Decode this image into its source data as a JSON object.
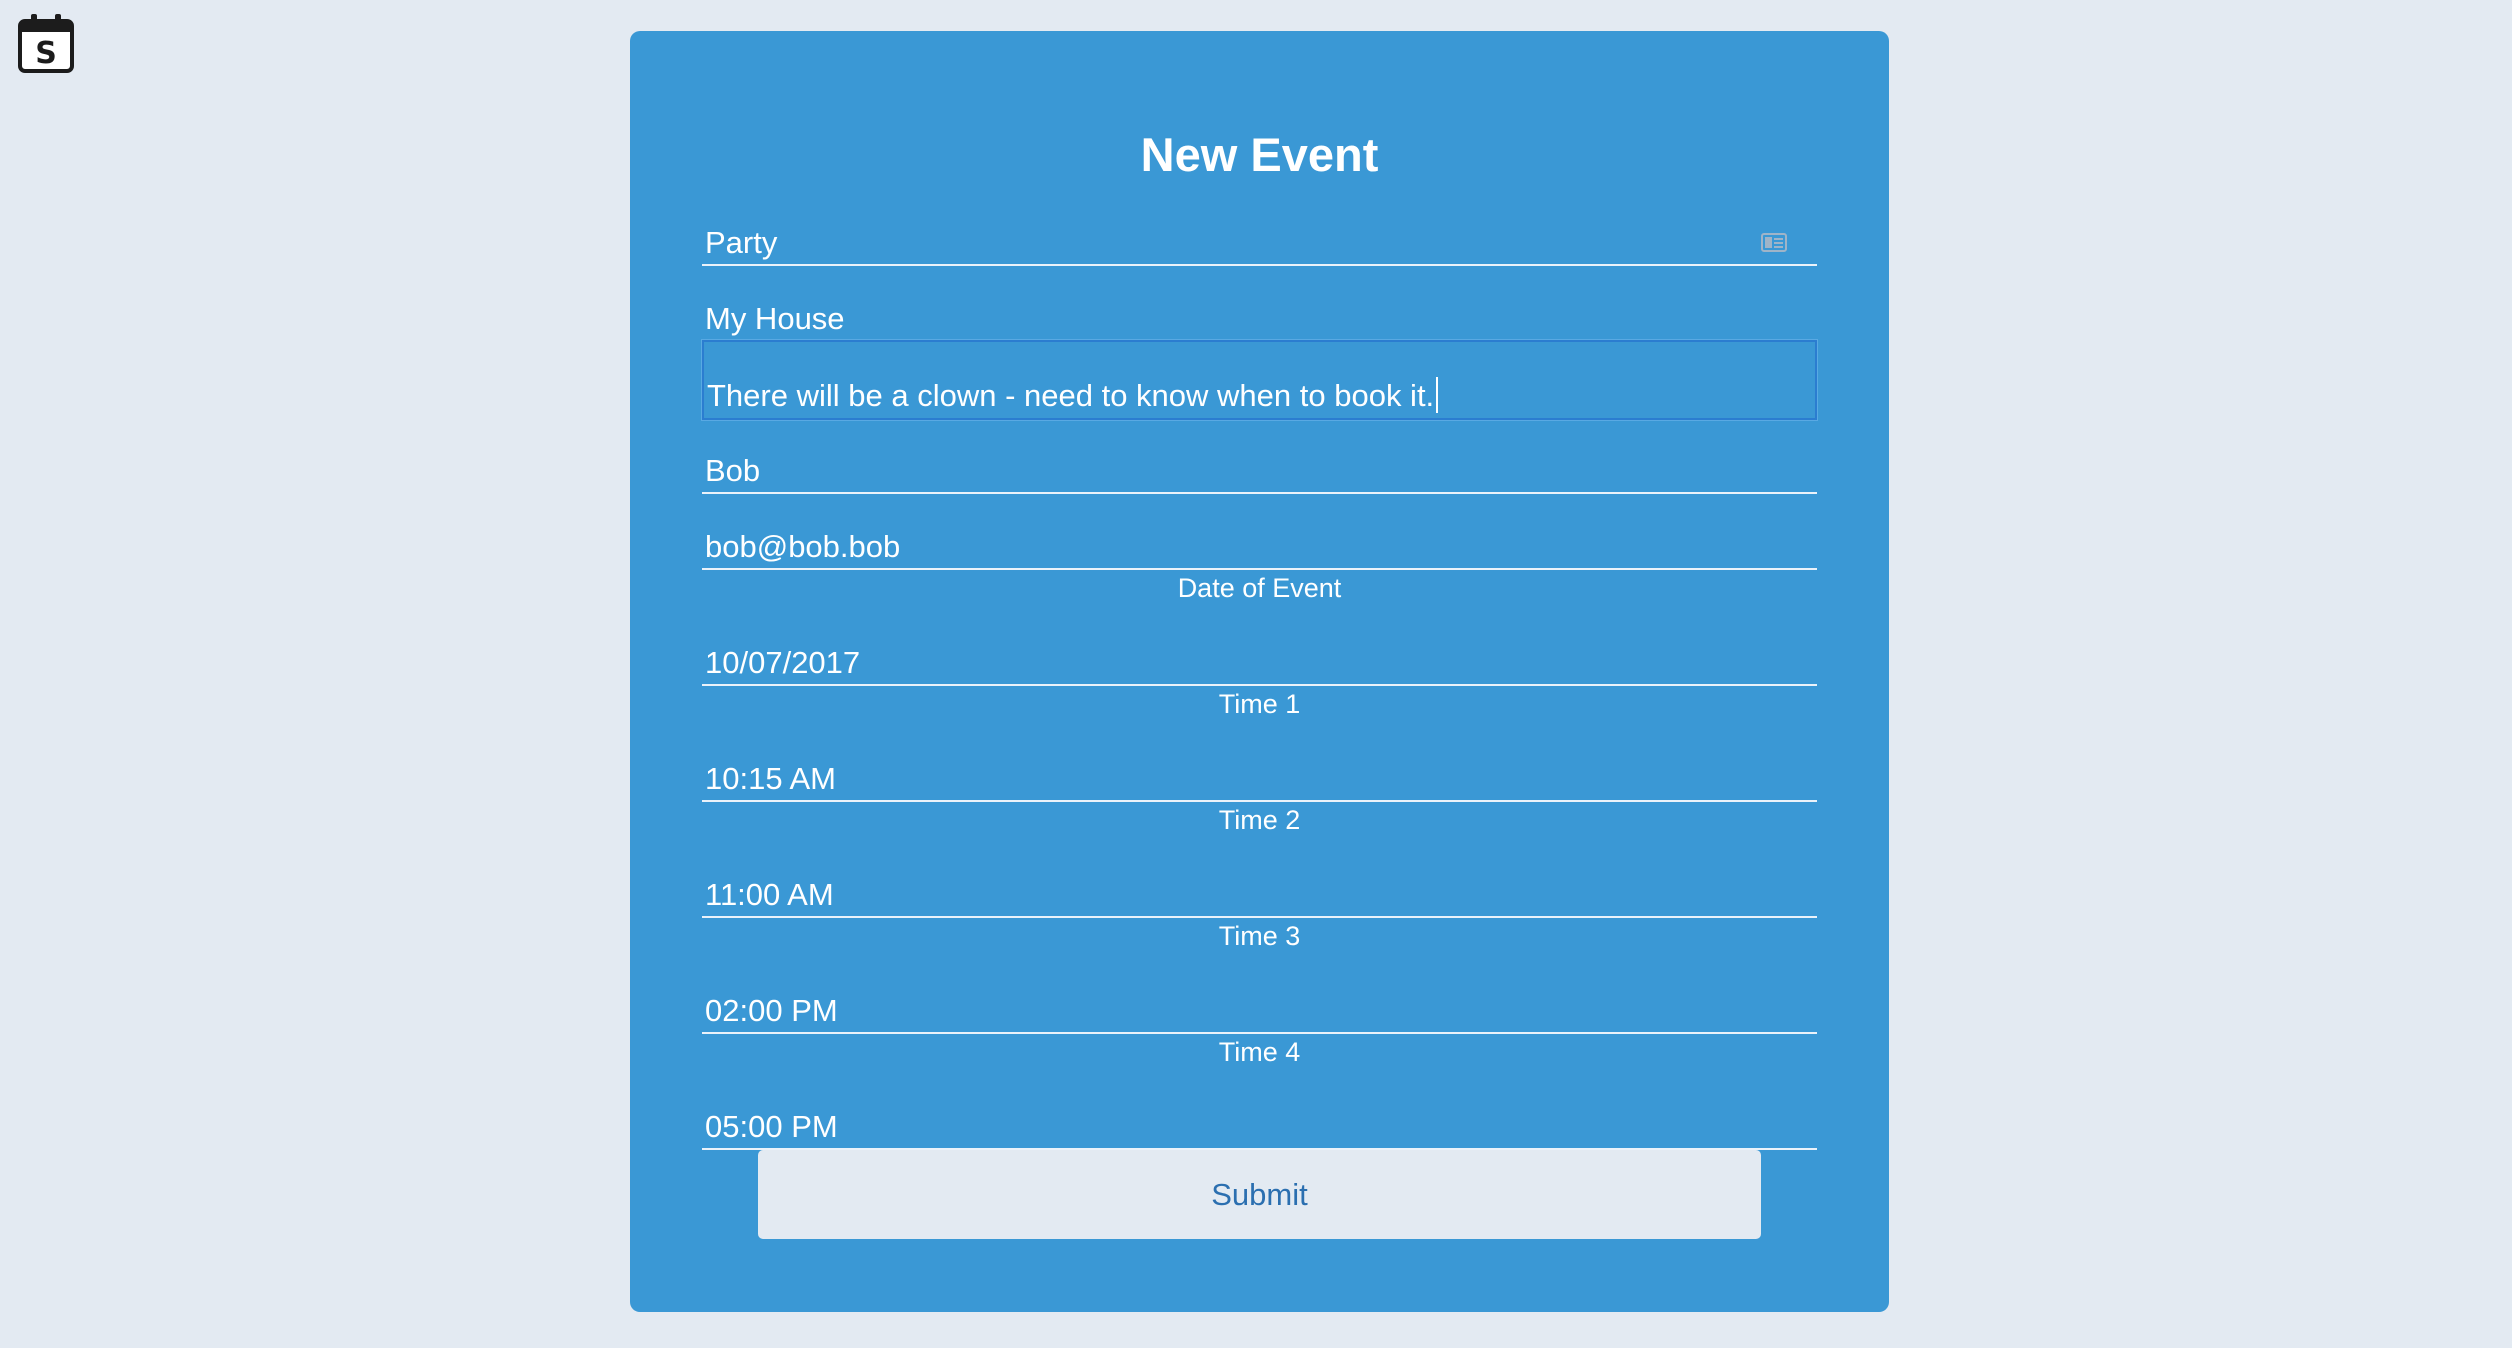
{
  "app": {
    "logo_icon": "calendar-s-icon",
    "logo_letter": "S"
  },
  "form": {
    "title": "New Event",
    "fields": [
      {
        "name": "event-name",
        "value": "Party",
        "has_autofill_icon": true
      },
      {
        "name": "location",
        "value": "My House"
      },
      {
        "name": "description",
        "value": "There will be a clown - need to know when to book it.",
        "focused": true
      },
      {
        "name": "organizer-name",
        "value": "Bob"
      },
      {
        "name": "organizer-email",
        "value": "bob@bob.bob"
      }
    ],
    "date": {
      "label": "Date of Event",
      "value": "10/07/2017"
    },
    "times": [
      {
        "label": "Time 1",
        "value": "10:15 AM"
      },
      {
        "label": "Time 2",
        "value": "11:00 AM"
      },
      {
        "label": "Time 3",
        "value": "02:00 PM"
      },
      {
        "label": "Time 4",
        "value": "05:00 PM"
      }
    ],
    "submit_label": "Submit"
  },
  "colors": {
    "background": "#e3eaf2",
    "card": "#3a98d5",
    "focus_border": "#2b7dd0",
    "button_text": "#2b6fb0"
  }
}
